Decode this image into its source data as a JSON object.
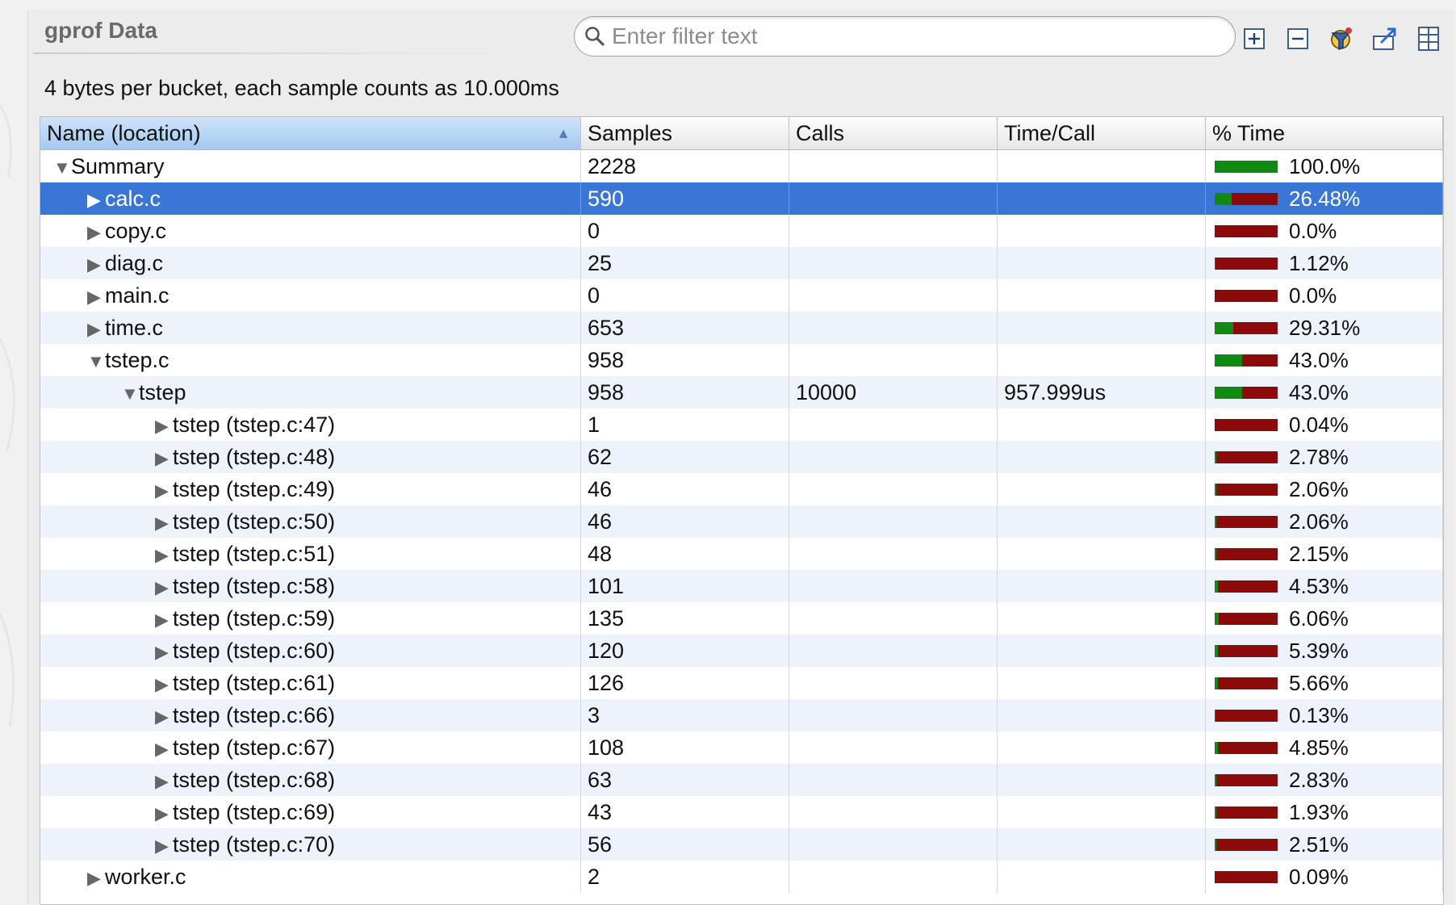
{
  "panel": {
    "title": "gprof Data"
  },
  "filter": {
    "placeholder": "Enter filter text"
  },
  "toolbar": {
    "icons": [
      "expand-all-icon",
      "collapse-all-icon",
      "filter-settings-icon",
      "export-icon",
      "table-columns-icon"
    ]
  },
  "info": "4 bytes per bucket, each sample counts as 10.000ms",
  "table": {
    "columns": [
      "Name (location)",
      "Samples",
      "Calls",
      "Time/Call",
      "% Time"
    ],
    "sorted_column": "Name (location)",
    "rows": [
      {
        "name": "Summary",
        "indent": 0,
        "expanded": true,
        "samples": "2228",
        "calls": "",
        "timecall": "",
        "pct": "100.0%",
        "pct_value": 100.0,
        "selected": false
      },
      {
        "name": "calc.c",
        "indent": 1,
        "expanded": false,
        "samples": "590",
        "calls": "",
        "timecall": "",
        "pct": "26.48%",
        "pct_value": 26.48,
        "selected": true
      },
      {
        "name": "copy.c",
        "indent": 1,
        "expanded": false,
        "samples": "0",
        "calls": "",
        "timecall": "",
        "pct": "0.0%",
        "pct_value": 0.0,
        "selected": false
      },
      {
        "name": "diag.c",
        "indent": 1,
        "expanded": false,
        "samples": "25",
        "calls": "",
        "timecall": "",
        "pct": "1.12%",
        "pct_value": 1.12,
        "selected": false
      },
      {
        "name": "main.c",
        "indent": 1,
        "expanded": false,
        "samples": "0",
        "calls": "",
        "timecall": "",
        "pct": "0.0%",
        "pct_value": 0.0,
        "selected": false
      },
      {
        "name": "time.c",
        "indent": 1,
        "expanded": false,
        "samples": "653",
        "calls": "",
        "timecall": "",
        "pct": "29.31%",
        "pct_value": 29.31,
        "selected": false
      },
      {
        "name": "tstep.c",
        "indent": 1,
        "expanded": true,
        "samples": "958",
        "calls": "",
        "timecall": "",
        "pct": "43.0%",
        "pct_value": 43.0,
        "selected": false
      },
      {
        "name": "tstep",
        "indent": 2,
        "expanded": true,
        "samples": "958",
        "calls": "10000",
        "timecall": "957.999us",
        "pct": "43.0%",
        "pct_value": 43.0,
        "selected": false
      },
      {
        "name": "tstep (tstep.c:47)",
        "indent": 3,
        "expanded": false,
        "samples": "1",
        "calls": "",
        "timecall": "",
        "pct": "0.04%",
        "pct_value": 0.04,
        "selected": false
      },
      {
        "name": "tstep (tstep.c:48)",
        "indent": 3,
        "expanded": false,
        "samples": "62",
        "calls": "",
        "timecall": "",
        "pct": "2.78%",
        "pct_value": 2.78,
        "selected": false
      },
      {
        "name": "tstep (tstep.c:49)",
        "indent": 3,
        "expanded": false,
        "samples": "46",
        "calls": "",
        "timecall": "",
        "pct": "2.06%",
        "pct_value": 2.06,
        "selected": false
      },
      {
        "name": "tstep (tstep.c:50)",
        "indent": 3,
        "expanded": false,
        "samples": "46",
        "calls": "",
        "timecall": "",
        "pct": "2.06%",
        "pct_value": 2.06,
        "selected": false
      },
      {
        "name": "tstep (tstep.c:51)",
        "indent": 3,
        "expanded": false,
        "samples": "48",
        "calls": "",
        "timecall": "",
        "pct": "2.15%",
        "pct_value": 2.15,
        "selected": false
      },
      {
        "name": "tstep (tstep.c:58)",
        "indent": 3,
        "expanded": false,
        "samples": "101",
        "calls": "",
        "timecall": "",
        "pct": "4.53%",
        "pct_value": 4.53,
        "selected": false
      },
      {
        "name": "tstep (tstep.c:59)",
        "indent": 3,
        "expanded": false,
        "samples": "135",
        "calls": "",
        "timecall": "",
        "pct": "6.06%",
        "pct_value": 6.06,
        "selected": false
      },
      {
        "name": "tstep (tstep.c:60)",
        "indent": 3,
        "expanded": false,
        "samples": "120",
        "calls": "",
        "timecall": "",
        "pct": "5.39%",
        "pct_value": 5.39,
        "selected": false
      },
      {
        "name": "tstep (tstep.c:61)",
        "indent": 3,
        "expanded": false,
        "samples": "126",
        "calls": "",
        "timecall": "",
        "pct": "5.66%",
        "pct_value": 5.66,
        "selected": false
      },
      {
        "name": "tstep (tstep.c:66)",
        "indent": 3,
        "expanded": false,
        "samples": "3",
        "calls": "",
        "timecall": "",
        "pct": "0.13%",
        "pct_value": 0.13,
        "selected": false
      },
      {
        "name": "tstep (tstep.c:67)",
        "indent": 3,
        "expanded": false,
        "samples": "108",
        "calls": "",
        "timecall": "",
        "pct": "4.85%",
        "pct_value": 4.85,
        "selected": false
      },
      {
        "name": "tstep (tstep.c:68)",
        "indent": 3,
        "expanded": false,
        "samples": "63",
        "calls": "",
        "timecall": "",
        "pct": "2.83%",
        "pct_value": 2.83,
        "selected": false
      },
      {
        "name": "tstep (tstep.c:69)",
        "indent": 3,
        "expanded": false,
        "samples": "43",
        "calls": "",
        "timecall": "",
        "pct": "1.93%",
        "pct_value": 1.93,
        "selected": false
      },
      {
        "name": "tstep (tstep.c:70)",
        "indent": 3,
        "expanded": false,
        "samples": "56",
        "calls": "",
        "timecall": "",
        "pct": "2.51%",
        "pct_value": 2.51,
        "selected": false
      },
      {
        "name": "worker.c",
        "indent": 1,
        "expanded": false,
        "samples": "2",
        "calls": "",
        "timecall": "",
        "pct": "0.09%",
        "pct_value": 0.09,
        "selected": false
      }
    ]
  },
  "colors": {
    "selection": "#3a76d5",
    "bar_time": "#118a11",
    "bar_remaining": "#8b0a0a",
    "row_alt": "#eef3fb",
    "header_sorted": "#a4c8ef"
  }
}
